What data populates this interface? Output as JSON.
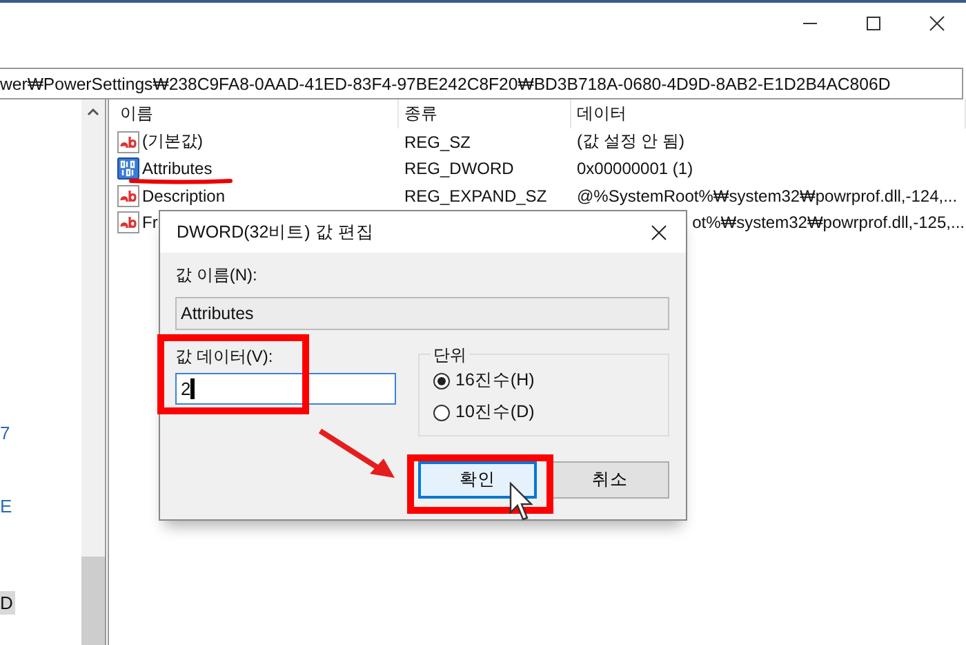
{
  "address_bar": {
    "path": "wer₩PowerSettings₩238C9FA8-0AAD-41ED-83F4-97BE242C8F20₩BD3B718A-0680-4D9D-8AB2-E1D2B4AC806D"
  },
  "tree": {
    "items": [
      {
        "label": "7",
        "selected": false
      },
      {
        "label": "E",
        "selected": false
      },
      {
        "label": "D",
        "selected": true
      }
    ]
  },
  "list": {
    "columns": [
      "이름",
      "종류",
      "데이터"
    ],
    "rows": [
      {
        "kind": "string",
        "name": "(기본값)",
        "type": "REG_SZ",
        "data": "(값 설정 안 됨)",
        "partial": false
      },
      {
        "kind": "dword",
        "name": "Attributes",
        "type": "REG_DWORD",
        "data": "0x00000001 (1)",
        "partial": false
      },
      {
        "kind": "string",
        "name": "Description",
        "type": "REG_EXPAND_SZ",
        "data": "@%SystemRoot%₩system32₩powrprof.dll,-124,...",
        "partial": false
      },
      {
        "kind": "string",
        "name": "Fr",
        "data": "ot%₩system32₩powrprof.dll,-125,...",
        "partial": true
      }
    ]
  },
  "dialog": {
    "title": "DWORD(32비트) 값 편집",
    "name_label": "값 이름(N):",
    "name_value": "Attributes",
    "data_label": "값 데이터(V):",
    "data_value": "2",
    "base_group": {
      "label": "단위",
      "options": [
        {
          "label": "16진수(H)",
          "selected": true
        },
        {
          "label": "10진수(D)",
          "selected": false
        }
      ]
    },
    "buttons": [
      {
        "label": "확인",
        "default": true
      },
      {
        "label": "취소",
        "default": false
      }
    ]
  }
}
